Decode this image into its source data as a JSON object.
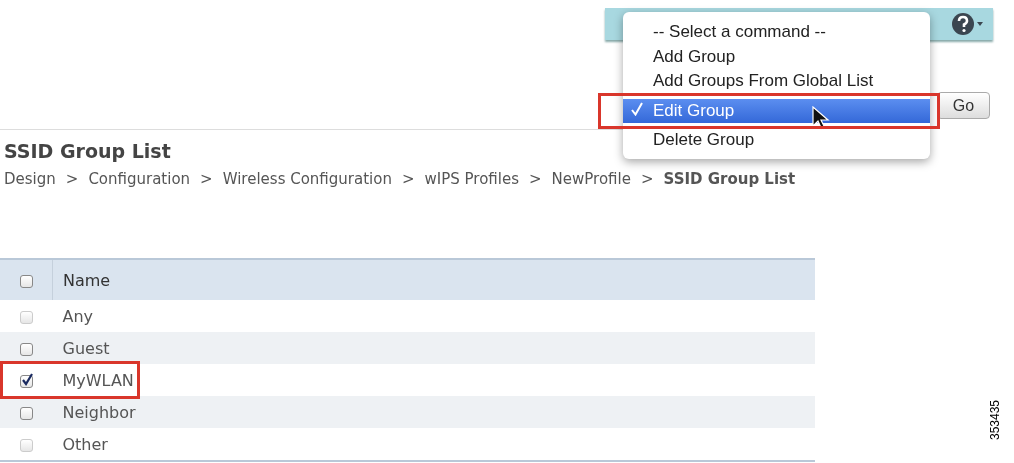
{
  "command_menu": {
    "items": [
      {
        "label": "-- Select a command --",
        "selected": false,
        "highlighted": false
      },
      {
        "label": "Add Group",
        "selected": false,
        "highlighted": false
      },
      {
        "label": "Add Groups From Global List",
        "selected": false,
        "highlighted": false
      },
      {
        "label": "Edit Group",
        "selected": true,
        "highlighted": true
      },
      {
        "label": "Delete Group",
        "selected": false,
        "highlighted": false
      }
    ]
  },
  "go_button": "Go",
  "page_title": "SSID Group List",
  "breadcrumb": [
    {
      "label": "Design",
      "current": false
    },
    {
      "label": "Configuration",
      "current": false
    },
    {
      "label": "Wireless Configuration",
      "current": false
    },
    {
      "label": "wIPS Profiles",
      "current": false
    },
    {
      "label": "NewProfile",
      "current": false
    },
    {
      "label": "SSID Group List",
      "current": true
    }
  ],
  "breadcrumb_separator": ">",
  "table": {
    "header_checked": false,
    "columns": [
      "Name"
    ],
    "rows": [
      {
        "name": "Any",
        "checked": false,
        "disabled": true,
        "highlighted": false
      },
      {
        "name": "Guest",
        "checked": false,
        "disabled": false,
        "highlighted": false
      },
      {
        "name": "MyWLAN",
        "checked": true,
        "disabled": false,
        "highlighted": true
      },
      {
        "name": "Neighbor",
        "checked": false,
        "disabled": false,
        "highlighted": false
      },
      {
        "name": "Other",
        "checked": false,
        "disabled": true,
        "highlighted": false
      }
    ]
  },
  "figure_number": "353435"
}
